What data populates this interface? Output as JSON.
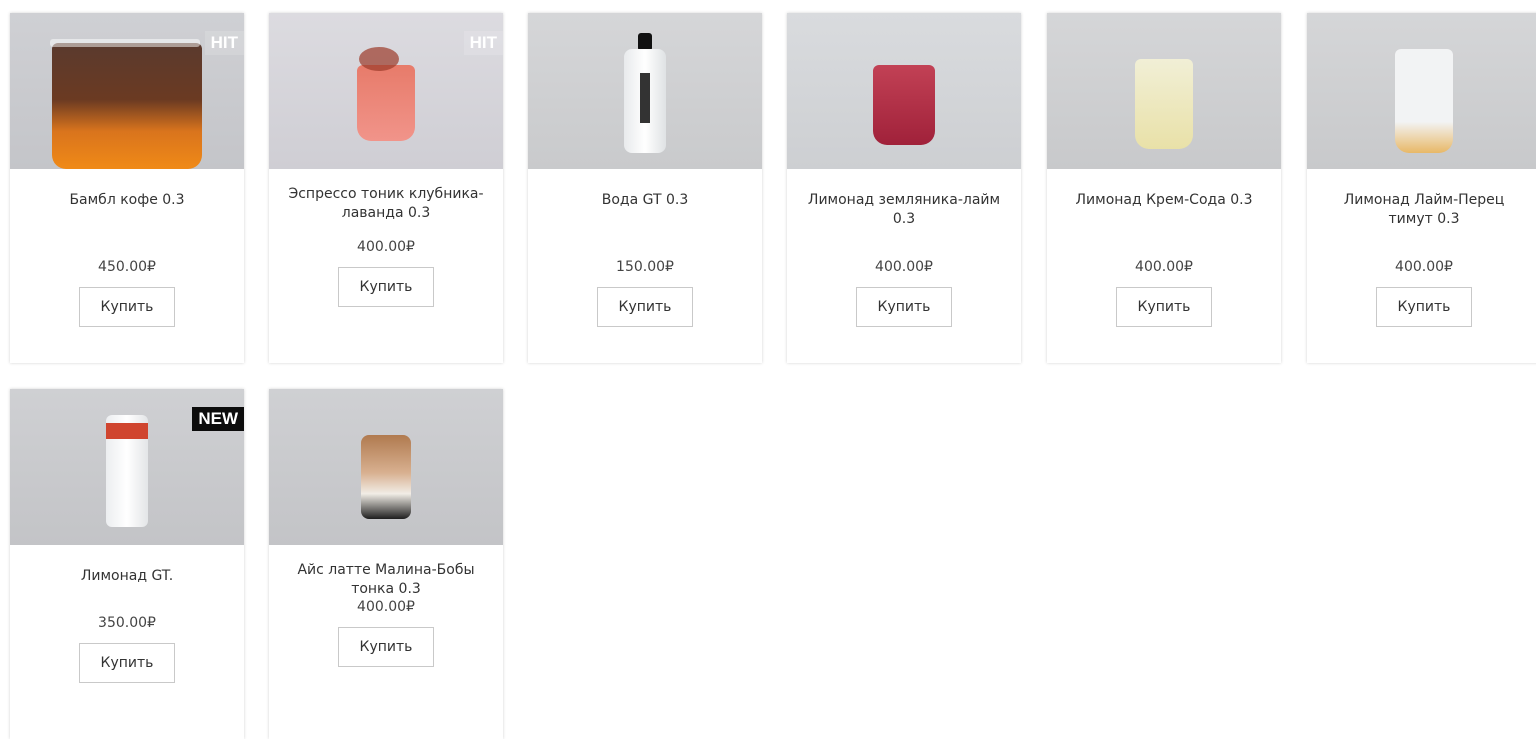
{
  "products": [
    {
      "name": "Бамбл кофе 0.3",
      "price": "450.00₽",
      "badge": "HIT",
      "buy_label": "Купить",
      "image": "iced-coffee-orange-cup"
    },
    {
      "name": "Эспрессо тоник клубника-лаванда 0.3",
      "price": "400.00₽",
      "badge": "HIT",
      "buy_label": "Купить",
      "image": "pink-tonic-cup"
    },
    {
      "name": "Вода GT 0.3",
      "price": "150.00₽",
      "badge": "",
      "buy_label": "Купить",
      "image": "water-bottle"
    },
    {
      "name": "Лимонад земляника-лайм 0.3",
      "price": "400.00₽",
      "badge": "",
      "buy_label": "Купить",
      "image": "red-lemonade-cup"
    },
    {
      "name": "Лимонад Крем-Сода 0.3",
      "price": "400.00₽",
      "badge": "",
      "buy_label": "Купить",
      "image": "pale-lemonade-cup"
    },
    {
      "name": "Лимонад Лайм-Перец тимут 0.3",
      "price": "400.00₽",
      "badge": "",
      "buy_label": "Купить",
      "image": "clear-lemonade-cup"
    },
    {
      "name": "Лимонад GT.",
      "price": "350.00₽",
      "badge": "NEW",
      "buy_label": "Купить",
      "image": "white-can"
    },
    {
      "name": "Айс латте Малина-Бобы тонка 0.3",
      "price": "400.00₽",
      "badge": "",
      "buy_label": "Купить",
      "image": "iced-latte-glass"
    }
  ]
}
